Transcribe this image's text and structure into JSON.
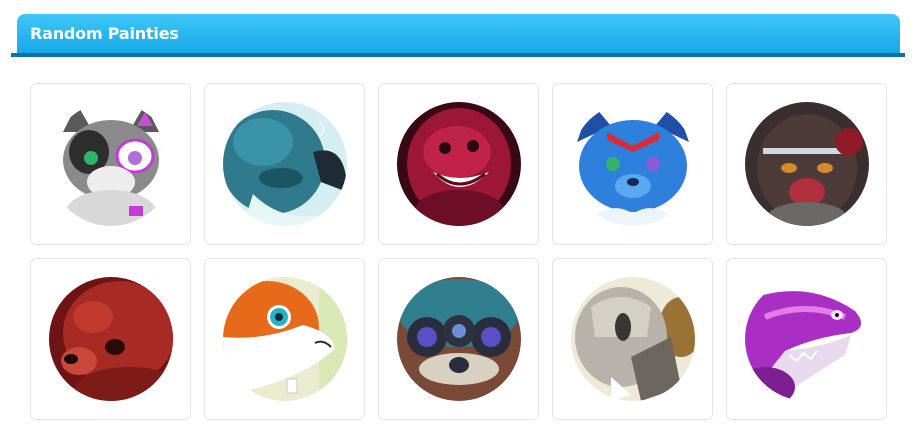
{
  "header": {
    "title": "Random Painties"
  },
  "painties": [
    {
      "id": 0,
      "icon": "cat-avatar-icon"
    },
    {
      "id": 1,
      "icon": "teal-dragon-avatar-icon"
    },
    {
      "id": 2,
      "icon": "red-creature-avatar-icon"
    },
    {
      "id": 3,
      "icon": "blue-wolf-avatar-icon"
    },
    {
      "id": 4,
      "icon": "dark-creature-avatar-icon"
    },
    {
      "id": 5,
      "icon": "red-bear-avatar-icon"
    },
    {
      "id": 6,
      "icon": "fox-avatar-icon"
    },
    {
      "id": 7,
      "icon": "spider-avatar-icon"
    },
    {
      "id": 8,
      "icon": "armored-creature-avatar-icon"
    },
    {
      "id": 9,
      "icon": "purple-shark-avatar-icon"
    }
  ]
}
